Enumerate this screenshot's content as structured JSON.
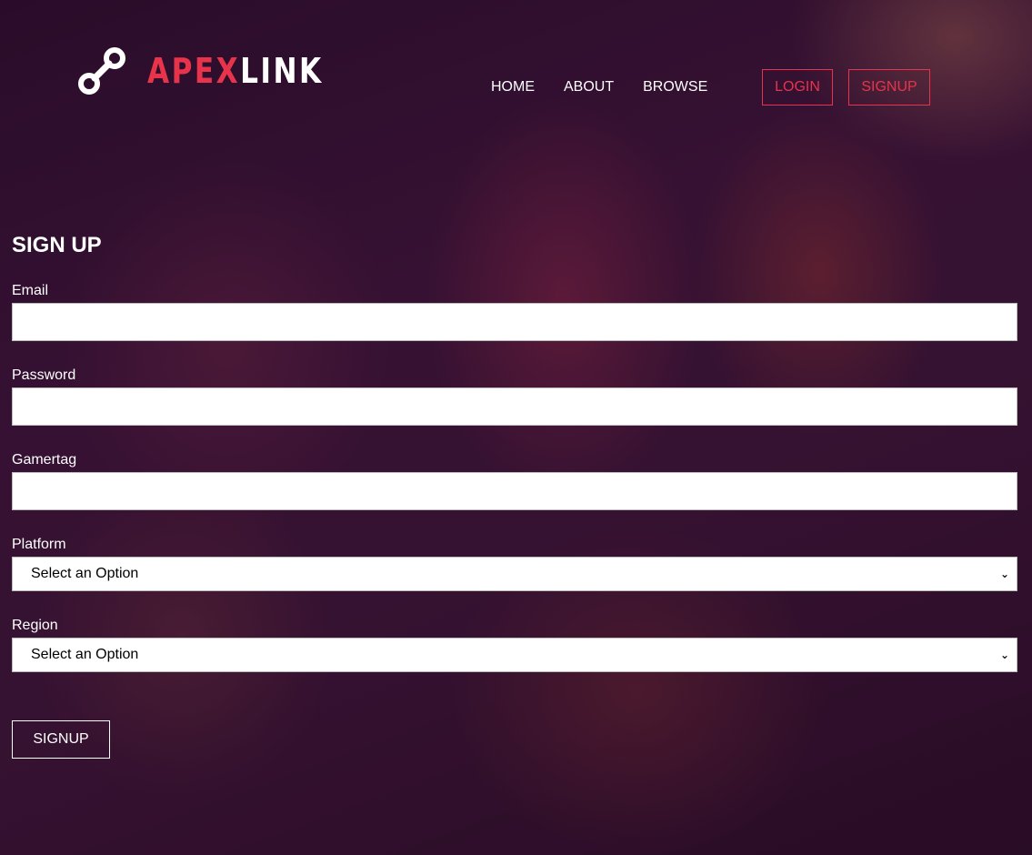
{
  "brand": {
    "name_accent": "APEX",
    "name_rest": "LINK",
    "logo_icon": "link-chain-icon",
    "accent_color": "#e8344a"
  },
  "nav": {
    "items": [
      "HOME",
      "ABOUT",
      "BROWSE"
    ]
  },
  "auth": {
    "login_label": "LOGIN",
    "signup_label": "SIGNUP"
  },
  "form": {
    "title": "SIGN UP",
    "email_label": "Email",
    "email_value": "",
    "password_label": "Password",
    "password_value": "",
    "gamertag_label": "Gamertag",
    "gamertag_value": "",
    "platform_label": "Platform",
    "platform_selected": "Select an Option",
    "region_label": "Region",
    "region_selected": "Select an Option",
    "submit_label": "SIGNUP"
  }
}
